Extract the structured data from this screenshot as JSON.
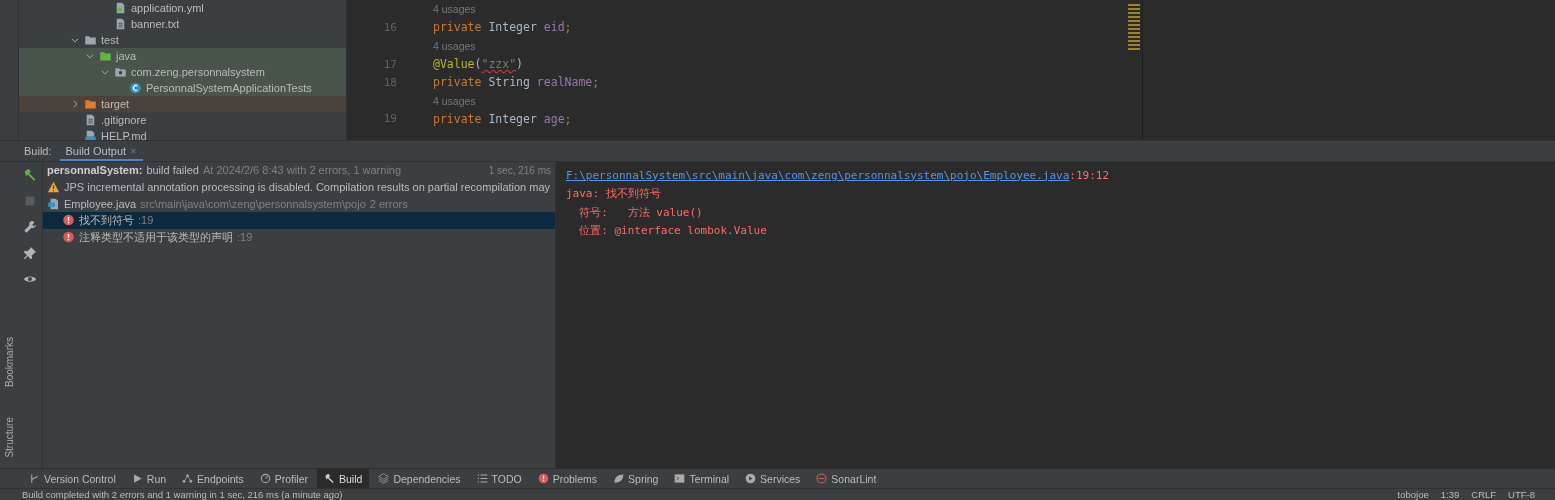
{
  "project_tree": {
    "cut_items": [
      {
        "label": "application.yml",
        "kind": "yml"
      },
      {
        "label": "banner.txt",
        "kind": "text"
      }
    ],
    "items": [
      {
        "label": "test",
        "kind": "folder",
        "expanded": true,
        "children": [
          {
            "label": "java",
            "kind": "test_source_folder",
            "expanded": true,
            "children": [
              {
                "label": "com.zeng.personnalsystem",
                "kind": "test_package",
                "expanded": true,
                "children": [
                  {
                    "label": "PersonnalSystemApplicationTests",
                    "kind": "test_class"
                  }
                ]
              }
            ]
          }
        ]
      },
      {
        "label": "target",
        "kind": "excluded_folder",
        "expanded": false
      },
      {
        "label": ".gitignore",
        "kind": "text"
      },
      {
        "label": "HELP.md",
        "kind": "markdown"
      }
    ]
  },
  "editor": {
    "lines": [
      {
        "kind": "hint",
        "text": "4 usages"
      },
      {
        "kind": "code",
        "number": "16",
        "tokens": [
          {
            "kind": "keyword",
            "text": "private"
          },
          {
            "kind": "plain",
            "text": " Integer "
          },
          {
            "kind": "field",
            "text": "eid"
          },
          {
            "kind": "keyword",
            "text": ";"
          }
        ]
      },
      {
        "kind": "hint",
        "text": "4 usages"
      },
      {
        "kind": "code",
        "number": "17",
        "tokens": [
          {
            "kind": "annotation",
            "text": "@Value"
          },
          {
            "kind": "plain",
            "text": "("
          },
          {
            "kind": "string_error",
            "text": "\"zzx\""
          },
          {
            "kind": "plain",
            "text": ")"
          }
        ]
      },
      {
        "kind": "code",
        "number": "18",
        "tokens": [
          {
            "kind": "keyword",
            "text": "private"
          },
          {
            "kind": "plain",
            "text": " String "
          },
          {
            "kind": "field",
            "text": "realName"
          },
          {
            "kind": "keyword",
            "text": ";"
          }
        ]
      },
      {
        "kind": "hint",
        "text": "4 usages"
      },
      {
        "kind": "code",
        "number": "19",
        "tokens": [
          {
            "kind": "keyword",
            "text": "private"
          },
          {
            "kind": "plain",
            "text": " Integer "
          },
          {
            "kind": "field",
            "text": "age"
          },
          {
            "kind": "keyword",
            "text": ";"
          }
        ]
      }
    ]
  },
  "build": {
    "label": "Build:",
    "tabs": [
      {
        "label": "Build Output",
        "selected": true,
        "close": "×"
      }
    ],
    "messages": [
      {
        "kind": "build",
        "title": "personnalSystem:",
        "status": "build failed",
        "detail": "At 2024/2/6 8:43 with 2 errors, 1 warning",
        "time": "1 sec, 216 ms",
        "selected": false
      },
      {
        "kind": "warning",
        "text": "JPS incremental annotation processing is disabled. Compilation results on partial recompilation may",
        "selected": false
      },
      {
        "kind": "file",
        "name": "Employee.java",
        "path": "src\\main\\java\\com\\zeng\\personnalsystem\\pojo",
        "count": "2 errors",
        "selected": false,
        "children": [
          {
            "kind": "error",
            "text": "找不到符号",
            "line": ":19",
            "selected": true
          },
          {
            "kind": "error",
            "text": "注释类型不适用于该类型的声明",
            "line": ":19",
            "selected": false
          }
        ]
      }
    ],
    "output": {
      "link": "F:\\personnalSystem\\src\\main\\java\\com\\zeng\\personnalsystem\\pojo\\Employee.java",
      "position": ":19:12",
      "lines": [
        "java: 找不到符号",
        "  符号:   方法 value()",
        "  位置: @interface lombok.Value"
      ]
    }
  },
  "side_labels": [
    "Bookmarks",
    "Structure"
  ],
  "tool_tabs": [
    {
      "label": "Version Control",
      "selected": false
    },
    {
      "label": "Run",
      "selected": false
    },
    {
      "label": "Endpoints",
      "selected": false
    },
    {
      "label": "Profiler",
      "selected": false
    },
    {
      "label": "Build",
      "selected": true
    },
    {
      "label": "Dependencies",
      "selected": false
    },
    {
      "label": "TODO",
      "selected": false
    },
    {
      "label": "Problems",
      "selected": false
    },
    {
      "label": "Spring",
      "selected": false
    },
    {
      "label": "Terminal",
      "selected": false
    },
    {
      "label": "Services",
      "selected": false
    },
    {
      "label": "SonarLint",
      "selected": false
    }
  ],
  "status_bar": {
    "message": "Build completed with 2 errors and 1 warning in 1 sec, 216 ms (a minute ago)",
    "items": [
      "tobojoe",
      "1:39",
      "CRLF",
      "UTF-8"
    ]
  }
}
